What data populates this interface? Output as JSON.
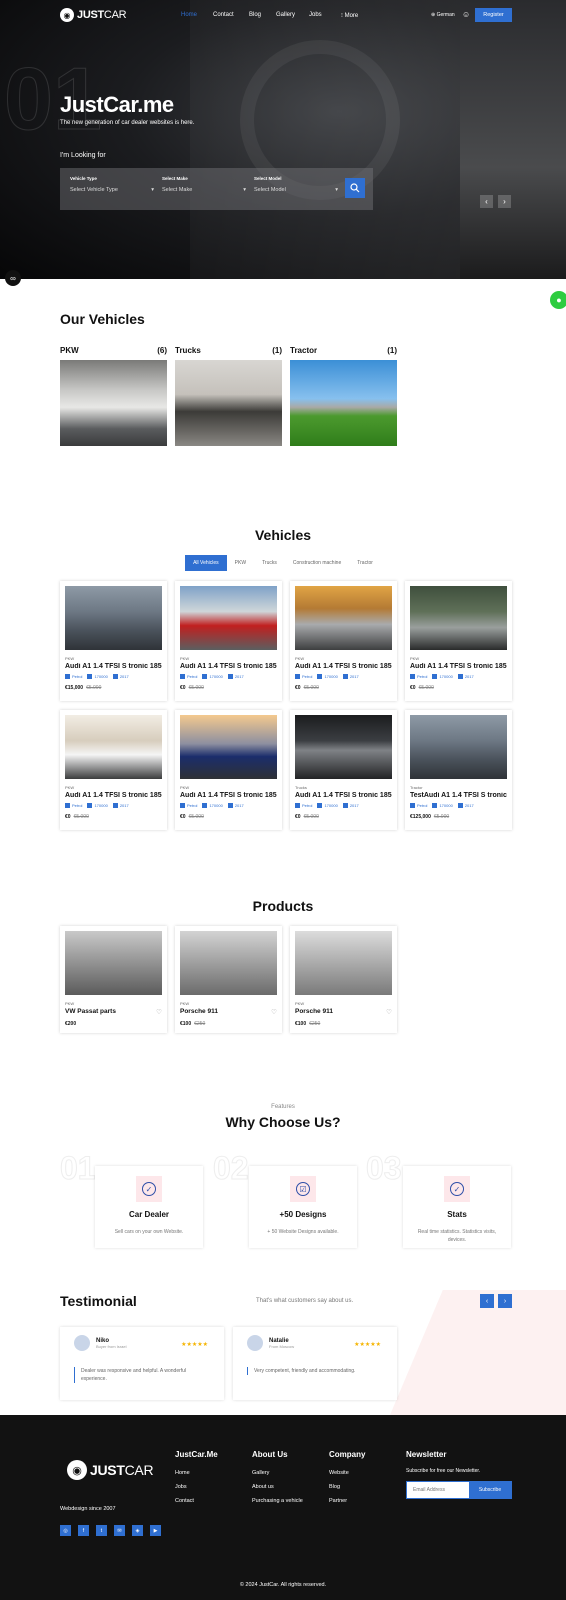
{
  "brand": {
    "logo_main": "JUST",
    "logo_sub": "CAR",
    "tagline": "Webdesign since 2007"
  },
  "nav": {
    "home": "Home",
    "contact": "Contact",
    "blog": "Blog",
    "gallery": "Gallery",
    "jobs": "Jobs",
    "more": "More",
    "language": "German",
    "register": "Register"
  },
  "hero": {
    "number": "01",
    "title": "JustCar.me",
    "subtitle": "The new generation of car dealer websites is here.",
    "looking": "I'm Looking for",
    "fields": [
      {
        "label": "Vehicle Type",
        "value": "Select Vehicle Type"
      },
      {
        "label": "Select Make",
        "value": "Select Make"
      },
      {
        "label": "Select Model",
        "value": "Select Model"
      }
    ]
  },
  "our_vehicles": {
    "title": "Our Vehicles",
    "categories": [
      {
        "name": "PKW",
        "count": "(6)"
      },
      {
        "name": "Trucks",
        "count": "(1)"
      },
      {
        "name": "Tractor",
        "count": "(1)"
      }
    ]
  },
  "vehicles": {
    "title": "Vehicles",
    "tabs": [
      "All Vehicles",
      "PKW",
      "Trucks",
      "Construction machine",
      "Tractor"
    ],
    "cards": [
      {
        "cat": "PKW",
        "name": "Audi A1 1.4 TFSI S tronic 185PS...",
        "fuel": "Petrol",
        "km": "170000",
        "year": "2017",
        "price": "€15,000",
        "old": "€5.000"
      },
      {
        "cat": "PKW",
        "name": "Audi A1 1.4 TFSI S tronic 185PS...",
        "fuel": "Petrol",
        "km": "170000",
        "year": "2017",
        "price": "€0",
        "old": "€5.000"
      },
      {
        "cat": "PKW",
        "name": "Audi A1 1.4 TFSI S tronic 185PS...",
        "fuel": "Petrol",
        "km": "170000",
        "year": "2017",
        "price": "€0",
        "old": "€5.000"
      },
      {
        "cat": "PKW",
        "name": "Audi A1 1.4 TFSI S tronic 185PS...",
        "fuel": "Petrol",
        "km": "170000",
        "year": "2017",
        "price": "€0",
        "old": "€5.000"
      },
      {
        "cat": "PKW",
        "name": "Audi A1 1.4 TFSI S tronic 185PS...",
        "fuel": "Petrol",
        "km": "170000",
        "year": "2017",
        "price": "€0",
        "old": "€5.000"
      },
      {
        "cat": "PKW",
        "name": "Audi A1 1.4 TFSI S tronic 185PS...",
        "fuel": "Petrol",
        "km": "170000",
        "year": "2017",
        "price": "€0",
        "old": "€5.000"
      },
      {
        "cat": "Trucks",
        "name": "Audi A1 1.4 TFSI S tronic 185PS...",
        "fuel": "Petrol",
        "km": "170000",
        "year": "2017",
        "price": "€0",
        "old": "€5.000"
      },
      {
        "cat": "Tractor",
        "name": "TestAudi A1 1.4 TFSI S tronic...",
        "fuel": "Petrol",
        "km": "170000",
        "year": "2017",
        "price": "€125,000",
        "old": "€5.000"
      }
    ]
  },
  "products": {
    "title": "Products",
    "cards": [
      {
        "cat": "PKW",
        "name": "VW Passat parts",
        "price": "€200",
        "old": ""
      },
      {
        "cat": "PKW",
        "name": "Porsche 911",
        "price": "€100",
        "old": "€250"
      },
      {
        "cat": "PKW",
        "name": "Porsche 911",
        "price": "€100",
        "old": "€250"
      }
    ]
  },
  "features": {
    "kicker": "Features",
    "title": "Why Choose Us?",
    "items": [
      {
        "num": "01",
        "title": "Car Dealer",
        "desc": "Sell cars on your own Website."
      },
      {
        "num": "02",
        "title": "+50 Designs",
        "desc": "+ 50 Website Designs available."
      },
      {
        "num": "03",
        "title": "Stats",
        "desc": "Real time statistics. Statistics visits, devices."
      }
    ]
  },
  "testimonial": {
    "title": "Testimonial",
    "sub": "That's what customers say about us.",
    "items": [
      {
        "name": "Niko",
        "role": "Buyer from Israel",
        "text": "Dealer was responsive and helpful. A wonderful experience."
      },
      {
        "name": "Natalie",
        "role": "From Moscow",
        "text": "Very competent, friendly and accommodating."
      }
    ]
  },
  "footer": {
    "col1": {
      "title": "JustCar.Me",
      "links": [
        "Home",
        "Jobs",
        "Contact"
      ]
    },
    "col2": {
      "title": "About Us",
      "links": [
        "Gallery",
        "About us",
        "Purchasing a vehicle"
      ]
    },
    "col3": {
      "title": "Company",
      "links": [
        "Website",
        "Blog",
        "Partner"
      ]
    },
    "newsletter": {
      "title": "Newsletter",
      "text": "Subscribe for free our Newsletter.",
      "placeholder": "Email Address",
      "button": "Subscribe"
    },
    "copyright": "© 2024 JustCar. All rights reserved."
  },
  "colors": {
    "accent": "#2f6fd1",
    "dark": "#121212"
  }
}
